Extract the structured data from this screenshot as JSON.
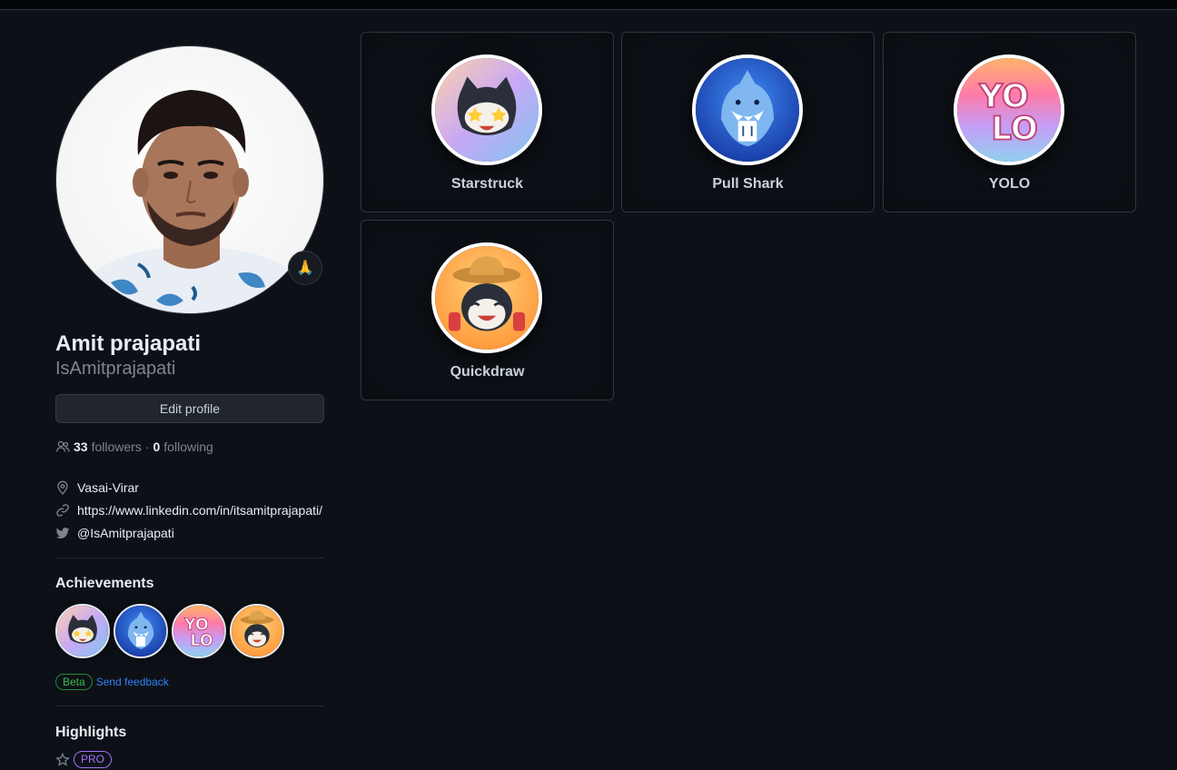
{
  "profile": {
    "name": "Amit prajapati",
    "login": "IsAmitprajapati",
    "status_emoji": "🙏",
    "edit_label": "Edit profile",
    "followers_count": "33",
    "followers_label": "followers",
    "separator": "·",
    "following_count": "0",
    "following_label": "following",
    "location": "Vasai-Virar",
    "website": "https://www.linkedin.com/in/itsamitprajapati/",
    "twitter": "@IsAmitprajapati"
  },
  "achievements_section": {
    "title": "Achievements",
    "beta_label": "Beta",
    "feedback_label": "Send feedback"
  },
  "highlights_section": {
    "title": "Highlights",
    "pro_label": "PRO"
  },
  "achievement_cards": [
    {
      "label": "Starstruck",
      "icon": "starstruck-badge-icon"
    },
    {
      "label": "Pull Shark",
      "icon": "pull-shark-badge-icon"
    },
    {
      "label": "YOLO",
      "icon": "yolo-badge-icon"
    },
    {
      "label": "Quickdraw",
      "icon": "quickdraw-badge-icon"
    }
  ],
  "colors": {
    "background": "#0d1117",
    "border": "#30363d",
    "accent_blue": "#2f81f7",
    "beta_green": "#3fb950",
    "pro_purple": "#a371f7"
  }
}
